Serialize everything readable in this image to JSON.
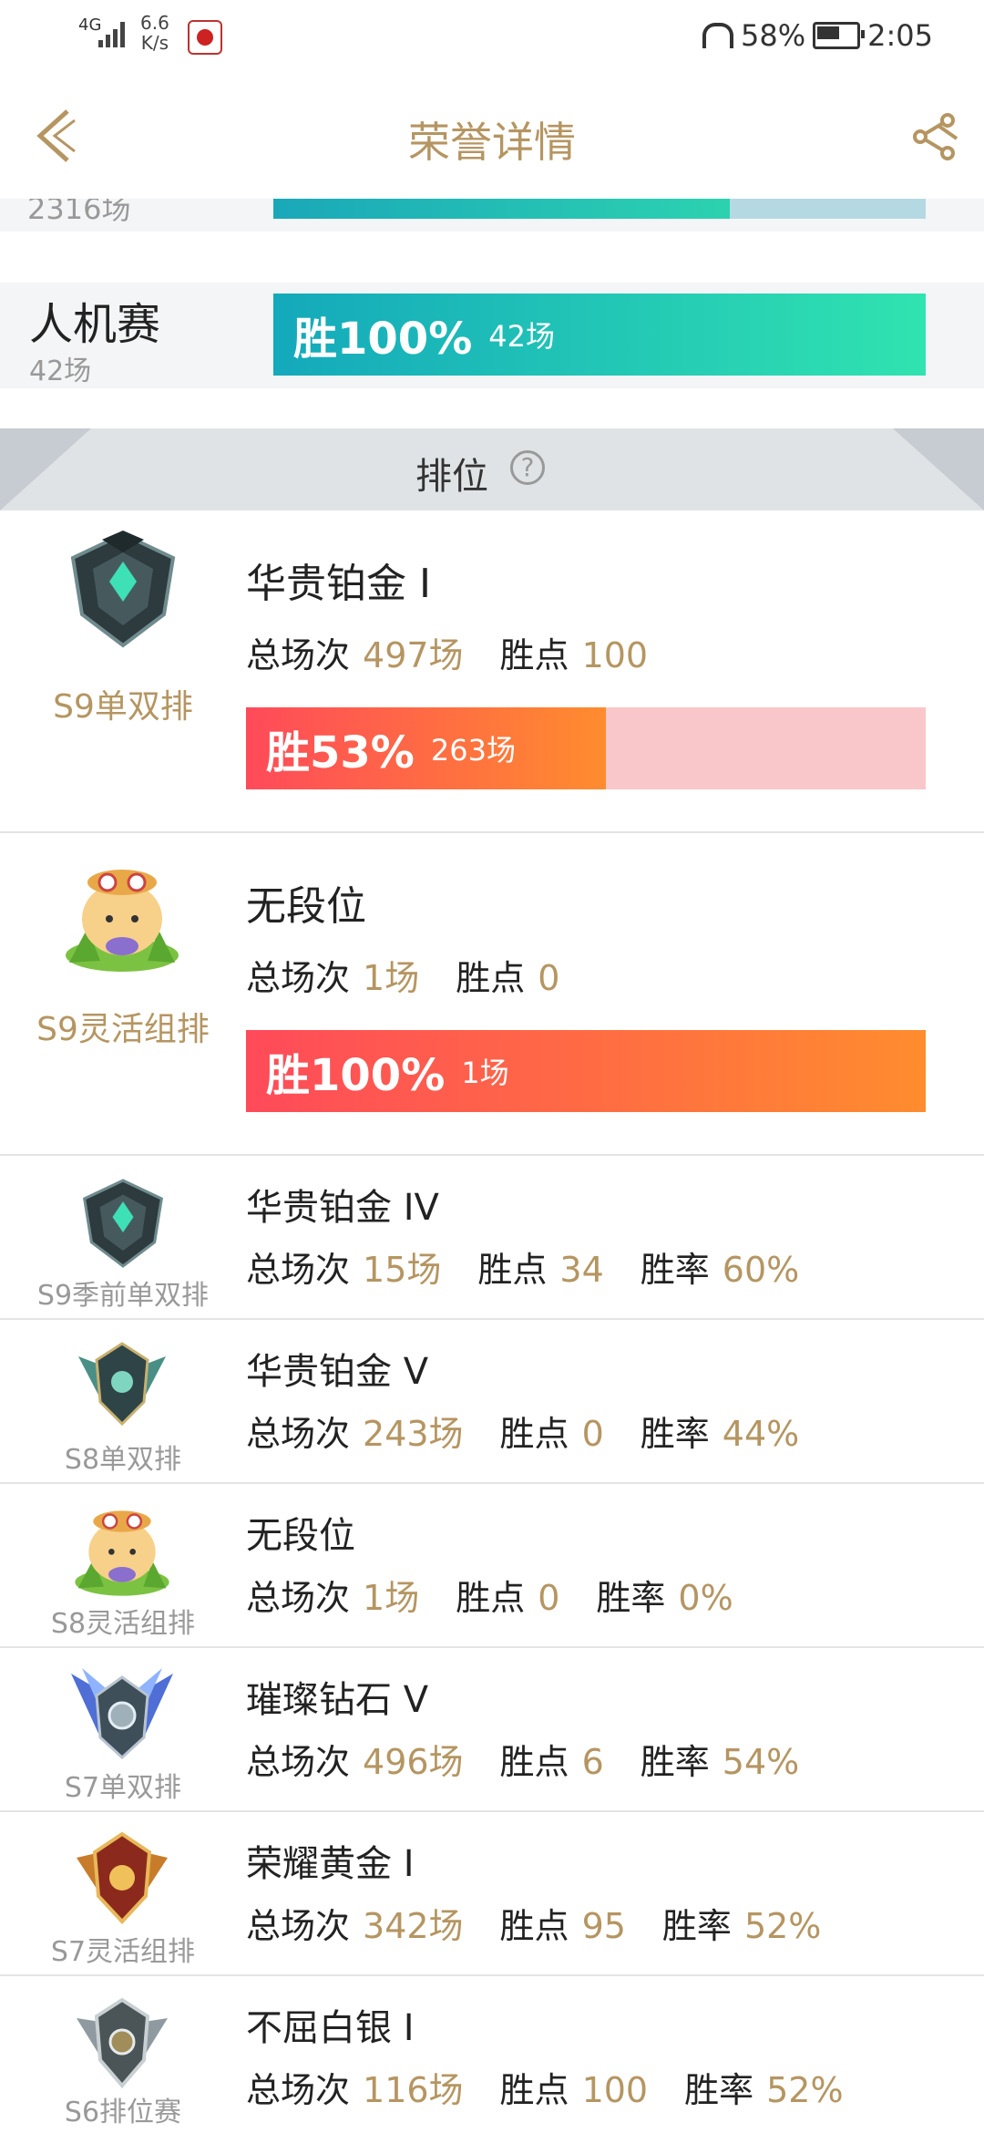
{
  "status_bar": {
    "network": "4G",
    "speed_value": "6.6",
    "speed_unit": "K/s",
    "battery": "58%",
    "time": "2:05"
  },
  "header": {
    "title": "荣誉详情"
  },
  "top_partial": {
    "count": "2316场",
    "win_fraction": 0.7
  },
  "bot_match": {
    "name": "人机赛",
    "count": "42场",
    "win_label": "胜100%",
    "games_label": "42场",
    "win_fraction": 1.0
  },
  "section": {
    "title": "排位",
    "help_symbol": "?"
  },
  "ranks_large": [
    {
      "season": "S9单双排",
      "tier": "华贵铂金 I",
      "total_label": "总场次",
      "total": "497场",
      "points_label": "胜点",
      "points": "100",
      "win_label": "胜53%",
      "wins": "263场",
      "win_fraction": 0.53,
      "emblem": "platinum-emblem"
    },
    {
      "season": "S9灵活组排",
      "tier": "无段位",
      "total_label": "总场次",
      "total": "1场",
      "points_label": "胜点",
      "points": "0",
      "win_label": "胜100%",
      "wins": "1场",
      "win_fraction": 1.0,
      "emblem": "teemo-emblem"
    }
  ],
  "ranks_small": [
    {
      "season": "S9季前单双排",
      "tier": "华贵铂金 IV",
      "total_label": "总场次",
      "total": "15场",
      "points_label": "胜点",
      "points": "34",
      "rate_label": "胜率",
      "rate": "60%",
      "emblem": "platinum-emblem"
    },
    {
      "season": "S8单双排",
      "tier": "华贵铂金 V",
      "total_label": "总场次",
      "total": "243场",
      "points_label": "胜点",
      "points": "0",
      "rate_label": "胜率",
      "rate": "44%",
      "emblem": "platinum-winged-emblem"
    },
    {
      "season": "S8灵活组排",
      "tier": "无段位",
      "total_label": "总场次",
      "total": "1场",
      "points_label": "胜点",
      "points": "0",
      "rate_label": "胜率",
      "rate": "0%",
      "emblem": "teemo-emblem"
    },
    {
      "season": "S7单双排",
      "tier": "璀璨钻石 V",
      "total_label": "总场次",
      "total": "496场",
      "points_label": "胜点",
      "points": "6",
      "rate_label": "胜率",
      "rate": "54%",
      "emblem": "diamond-emblem"
    },
    {
      "season": "S7灵活组排",
      "tier": "荣耀黄金 I",
      "total_label": "总场次",
      "total": "342场",
      "points_label": "胜点",
      "points": "95",
      "rate_label": "胜率",
      "rate": "52%",
      "emblem": "gold-emblem"
    },
    {
      "season": "S6排位赛",
      "tier": "不屈白银 I",
      "total_label": "总场次",
      "total": "116场",
      "points_label": "胜点",
      "points": "100",
      "rate_label": "胜率",
      "rate": "52%",
      "emblem": "silver-emblem"
    }
  ],
  "colors": {
    "accent": "#b59561",
    "win_gradient_start": "#ff4a5a",
    "win_gradient_end": "#ff8c2e",
    "bot_gradient_start": "#14a9bb",
    "bot_gradient_end": "#30e3b0"
  }
}
